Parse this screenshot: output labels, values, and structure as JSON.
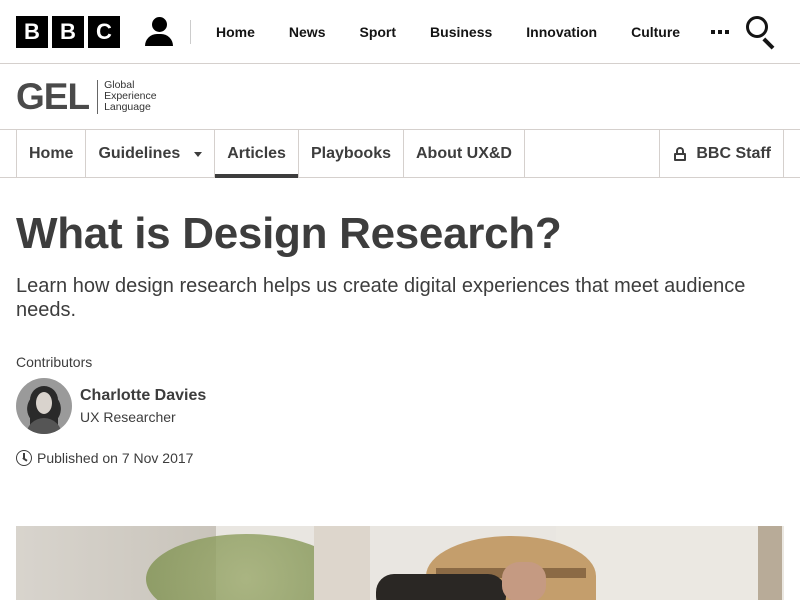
{
  "brand": {
    "letters": [
      "B",
      "B",
      "C"
    ]
  },
  "top_nav": {
    "items": [
      {
        "label": "Home"
      },
      {
        "label": "News"
      },
      {
        "label": "Sport"
      },
      {
        "label": "Business"
      },
      {
        "label": "Innovation"
      },
      {
        "label": "Culture"
      }
    ]
  },
  "gel": {
    "logo_text": "GEL",
    "subtitle_lines": [
      "Global",
      "Experience",
      "Language"
    ]
  },
  "section_nav": {
    "items": [
      {
        "label": "Home",
        "active": false
      },
      {
        "label": "Guidelines",
        "active": false,
        "has_dropdown": true
      },
      {
        "label": "Articles",
        "active": true
      },
      {
        "label": "Playbooks",
        "active": false
      },
      {
        "label": "About UX&D",
        "active": false
      }
    ],
    "staff_label": "BBC Staff"
  },
  "article": {
    "title": "What is Design Research?",
    "lede": "Learn how design research helps us create digital experiences that meet audience needs.",
    "contributors_label": "Contributors",
    "contributor": {
      "name": "Charlotte Davies",
      "role": "UX Researcher"
    },
    "published": "Published on 7 Nov 2017"
  }
}
